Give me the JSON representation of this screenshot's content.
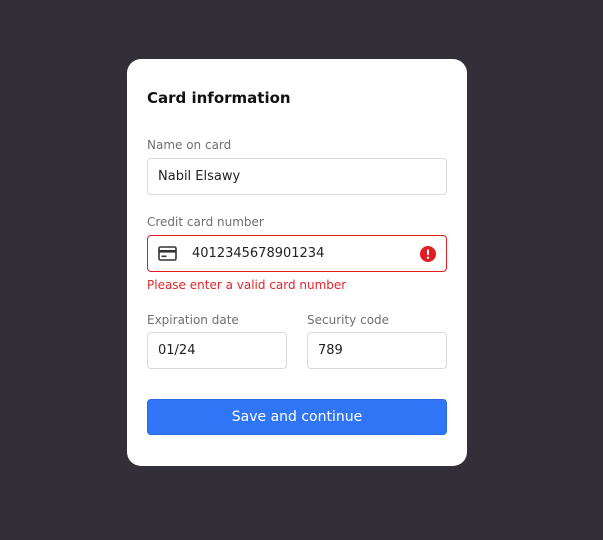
{
  "form": {
    "title": "Card information",
    "name_label": "Name on card",
    "name_value": "Nabil Elsawy",
    "card_label": "Credit card number",
    "card_value": "4012345678901234",
    "card_error": "Please enter a valid card number",
    "expiry_label": "Expiration date",
    "expiry_value": "01/24",
    "cvc_label": "Security code",
    "cvc_value": "789",
    "submit_label": "Save and continue"
  },
  "icons": {
    "card": "credit-card-icon",
    "error": "error-alert-icon"
  },
  "colors": {
    "background": "#322f38",
    "card": "#ffffff",
    "error": "#e11d24",
    "primary": "#2f75f6"
  }
}
